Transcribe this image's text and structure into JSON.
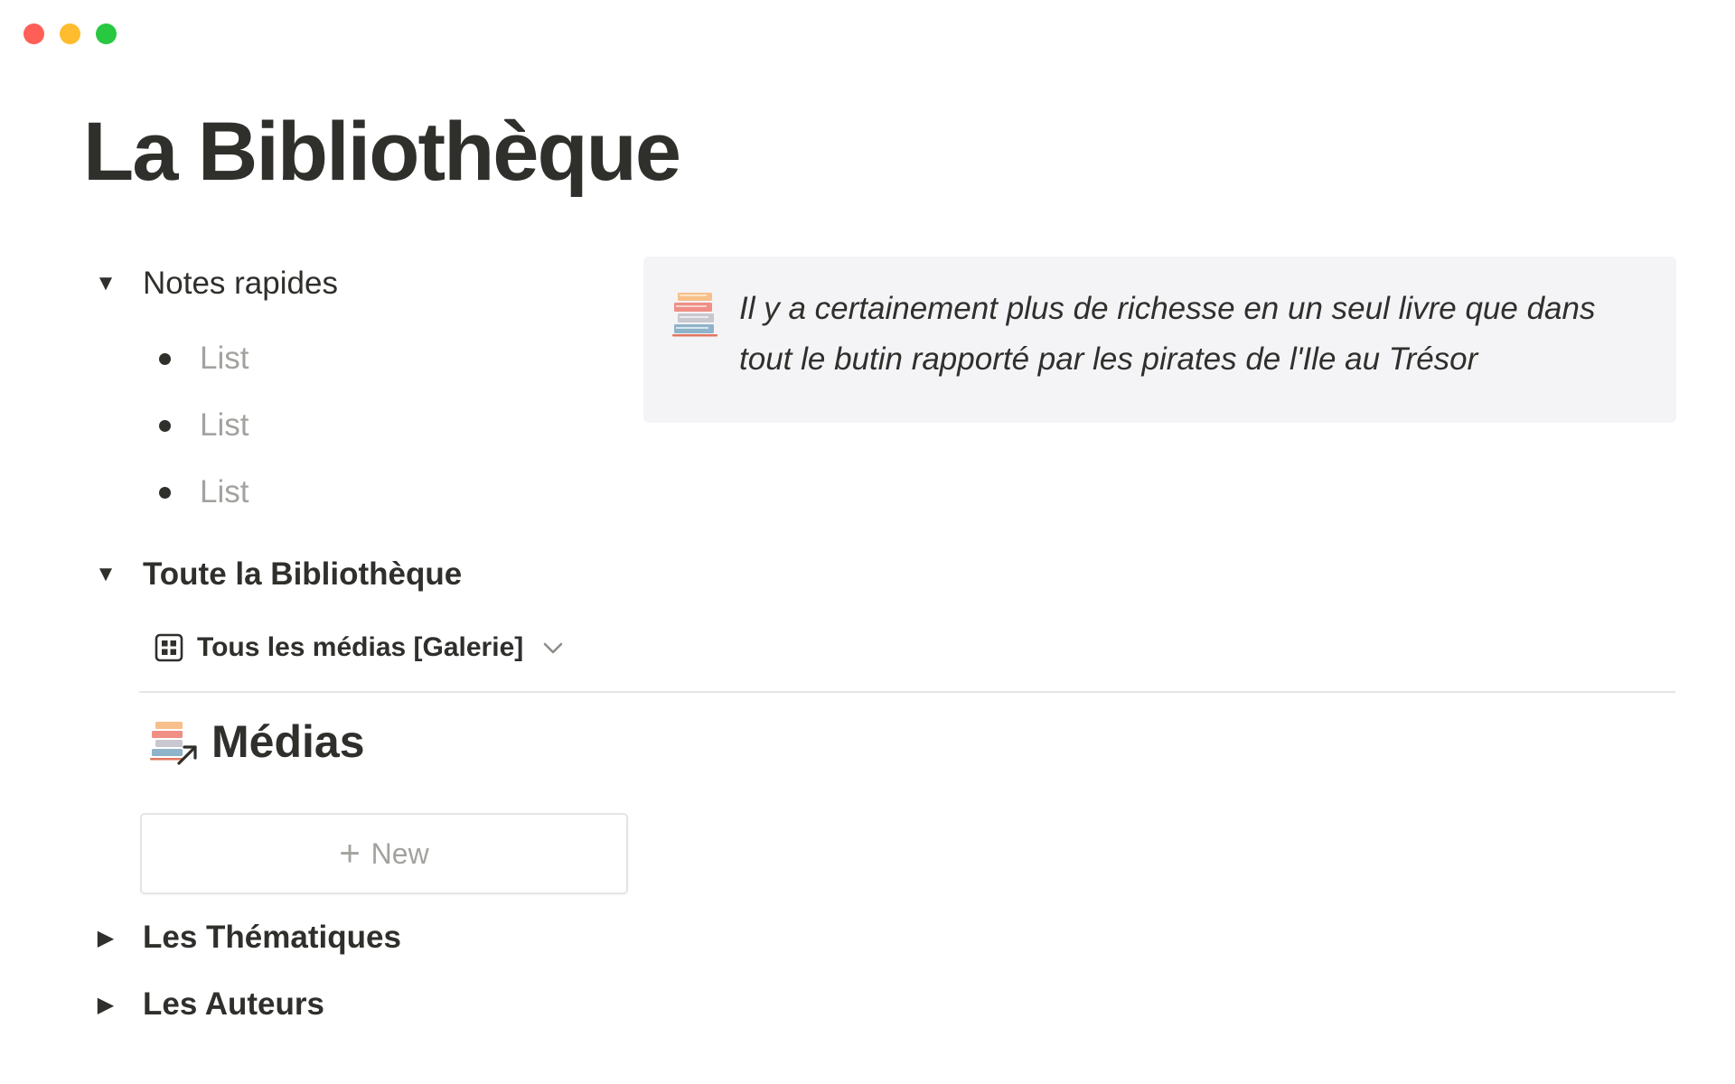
{
  "window": {
    "controls": [
      "close",
      "minimize",
      "zoom"
    ]
  },
  "page": {
    "title": "La Bibliothèque"
  },
  "notes": {
    "toggle_label": "Notes rapides",
    "items": [
      "List",
      "List",
      "List"
    ]
  },
  "callout": {
    "icon": "books-icon",
    "text": "Il y a certainement plus de richesse en un seul livre que dans tout le butin rapporté par les pirates de l'Ile au Trésor"
  },
  "library": {
    "toggle_label": "Toute la Bibliothèque",
    "view_label": "Tous les médias [Galerie]",
    "db_title": "Médias",
    "new_label": "New"
  },
  "toggles": {
    "themes_label": "Les Thématiques",
    "authors_label": "Les Auteurs"
  },
  "colors": {
    "text": "#2f2f2c",
    "muted": "#a3a29f",
    "callout_bg": "#f4f3f6",
    "divider": "#e6e5e3"
  }
}
